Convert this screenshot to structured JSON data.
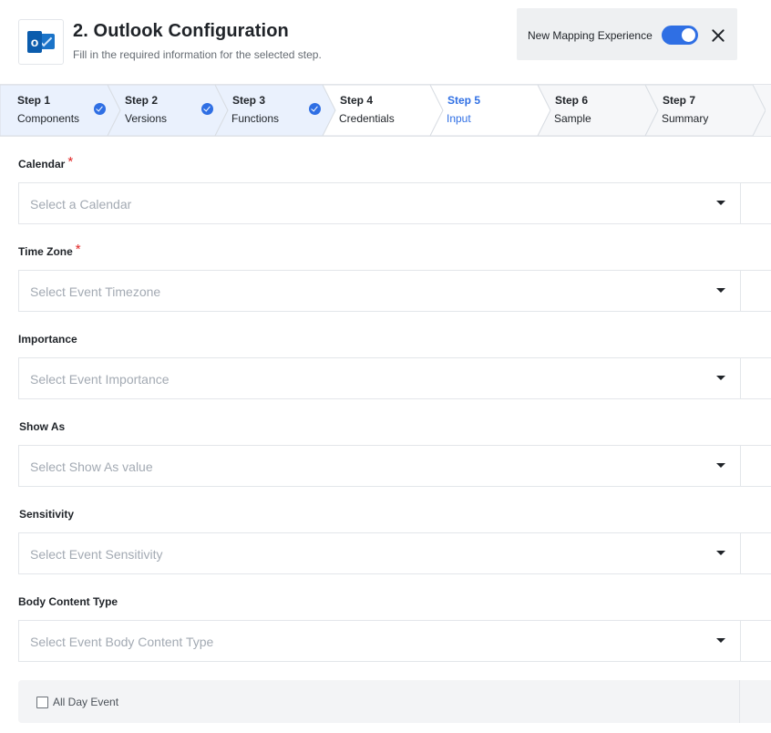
{
  "header": {
    "title": "2. Outlook Configuration",
    "subtitle": "Fill in the required information for the selected step.",
    "app_icon": "outlook-icon",
    "mapping_label": "New Mapping Experience",
    "mapping_enabled": true,
    "accent_color": "#2f6fe4"
  },
  "steps": [
    {
      "num": "Step 1",
      "label": "Components",
      "completed": true
    },
    {
      "num": "Step 2",
      "label": "Versions",
      "completed": true
    },
    {
      "num": "Step 3",
      "label": "Functions",
      "completed": true
    },
    {
      "num": "Step 4",
      "label": "Credentials",
      "completed": false
    },
    {
      "num": "Step 5",
      "label": "Input",
      "completed": false,
      "active": true
    },
    {
      "num": "Step 6",
      "label": "Sample",
      "completed": false
    },
    {
      "num": "Step 7",
      "label": "Summary",
      "completed": false
    }
  ],
  "fields": [
    {
      "label": "Calendar",
      "required": true,
      "placeholder": "Select a Calendar"
    },
    {
      "label": "Time Zone",
      "required": true,
      "placeholder": "Select Event Timezone"
    },
    {
      "label": "Importance",
      "required": false,
      "placeholder": "Select Event Importance"
    },
    {
      "label": "Show As",
      "required": false,
      "placeholder": "Select Show As value"
    },
    {
      "label": "Sensitivity",
      "required": false,
      "placeholder": "Select Event Sensitivity"
    },
    {
      "label": "Body Content Type",
      "required": false,
      "placeholder": "Select Event Body Content Type"
    }
  ],
  "all_day": {
    "label": "All Day Event",
    "checked": false
  },
  "required_marker": "*"
}
